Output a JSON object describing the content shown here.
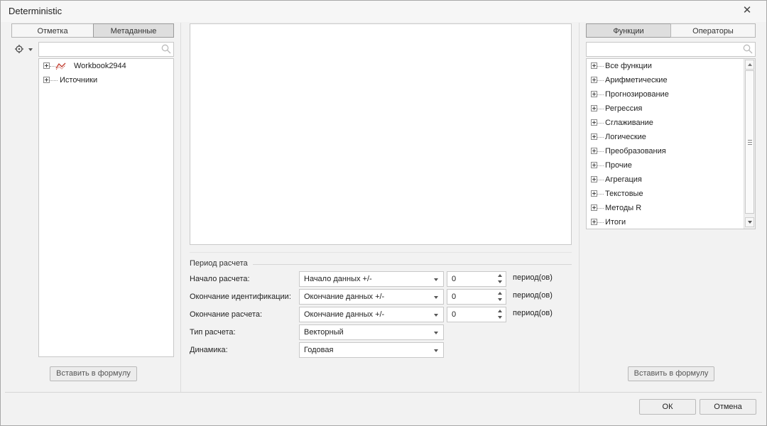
{
  "window": {
    "title": "Deterministic"
  },
  "left_panel": {
    "tabs": [
      "Отметка",
      "Метаданные"
    ],
    "active_tab": 1,
    "search_placeholder": "",
    "tree": [
      "Workbook2944",
      "Источники"
    ],
    "insert_button": "Вставить в формулу"
  },
  "calc_period": {
    "section_title": "Период расчета",
    "rows": [
      {
        "label": "Начало расчета:",
        "combo": "Начало данных +/-",
        "spin": "0",
        "unit": "период(ов)"
      },
      {
        "label": "Окончание идентификации:",
        "combo": "Окончание данных +/-",
        "spin": "0",
        "unit": "период(ов)"
      },
      {
        "label": "Окончание расчета:",
        "combo": "Окончание данных +/-",
        "spin": "0",
        "unit": "период(ов)"
      },
      {
        "label": "Тип расчета:",
        "combo": "Векторный"
      },
      {
        "label": "Динамика:",
        "combo": "Годовая"
      }
    ]
  },
  "right_panel": {
    "tabs": [
      "Функции",
      "Операторы"
    ],
    "active_tab": 0,
    "search_placeholder": "",
    "functions": [
      "Все функции",
      "Арифметические",
      "Прогнозирование",
      "Регрессия",
      "Сглаживание",
      "Логические",
      "Преобразования",
      "Прочие",
      "Агрегация",
      "Текстовые",
      "Методы R",
      "Итоги"
    ],
    "insert_button": "Вставить в формулу"
  },
  "footer": {
    "ok": "ОК",
    "cancel": "Отмена"
  },
  "colors": {
    "workbook_icon": "#c0392b",
    "active_tab_bg": "#dedede"
  }
}
